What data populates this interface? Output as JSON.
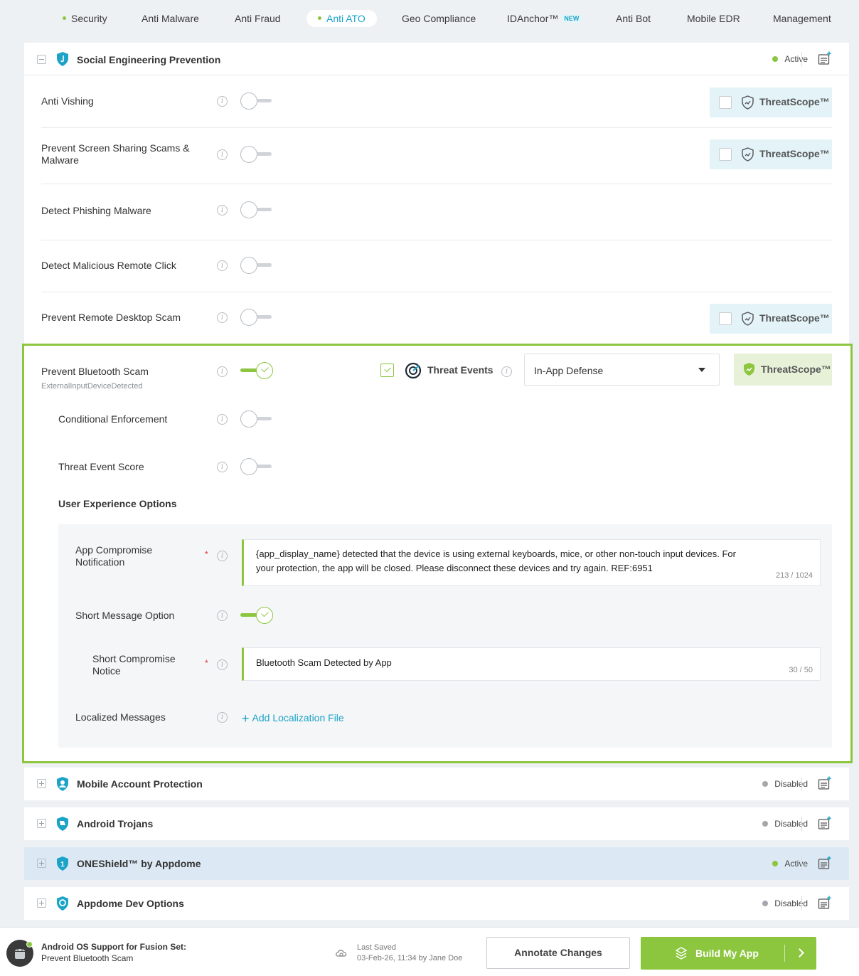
{
  "tabs": [
    {
      "label": "Security",
      "dot": true
    },
    {
      "label": "Anti Malware"
    },
    {
      "label": "Anti Fraud"
    },
    {
      "label": "Anti ATO",
      "dot": true,
      "active": true
    },
    {
      "label": "Geo Compliance"
    },
    {
      "label": "IDAnchor™",
      "badge": "NEW"
    },
    {
      "label": "Anti Bot"
    },
    {
      "label": "Mobile EDR"
    },
    {
      "label": "Management"
    }
  ],
  "social": {
    "title": "Social Engineering Prevention",
    "status": "Active",
    "rows": [
      {
        "label": "Anti Vishing",
        "threatscope": true
      },
      {
        "label": "Prevent Screen Sharing Scams & Malware",
        "threatscope": true
      },
      {
        "label": "Detect Phishing Malware",
        "threatscope": false
      },
      {
        "label": "Detect Malicious Remote Click",
        "threatscope": false
      },
      {
        "label": "Prevent Remote Desktop Scam",
        "threatscope": true
      }
    ],
    "threatscope_label": "ThreatScope™"
  },
  "bluetooth": {
    "label": "Prevent Bluetooth Scam",
    "sub": "ExternalInputDeviceDetected",
    "threat_events_label": "Threat Events",
    "defense_select": "In-App Defense",
    "threatscope_label": "ThreatScope™",
    "conditional_label": "Conditional Enforcement",
    "score_label": "Threat Event Score",
    "ux_title": "User Experience Options",
    "notif_label": "App Compromise Notification",
    "notif_text": "{app_display_name} detected that the device is using external keyboards, mice, or other non-touch input devices. For your protection, the app will be closed. Please disconnect these devices and try again. REF:6951",
    "notif_count": "213 / 1024",
    "short_msg_label": "Short Message Option",
    "short_notice_label": "Short Compromise Notice",
    "short_notice_text": "Bluetooth Scam Detected by App",
    "short_notice_count": "30 / 50",
    "localized_label": "Localized Messages",
    "add_localization": "Add Localization File"
  },
  "sections": [
    {
      "title": "Mobile Account Protection",
      "status": "Disabled"
    },
    {
      "title": "Android Trojans",
      "status": "Disabled"
    },
    {
      "title": "ONEShield™ by Appdome",
      "status": "Active"
    },
    {
      "title": "Appdome Dev Options",
      "status": "Disabled"
    }
  ],
  "footer": {
    "line1": "Android OS Support for Fusion Set:",
    "line2": "Prevent Bluetooth Scam",
    "saved_title": "Last Saved",
    "saved_value": "03-Feb-26, 11:34 by Jane Doe",
    "annotate": "Annotate Changes",
    "build": "Build My App"
  },
  "colors": {
    "accent_green": "#8cc63f",
    "accent_blue": "#1ba3c8",
    "disabled_gray": "#a3a8ad"
  }
}
